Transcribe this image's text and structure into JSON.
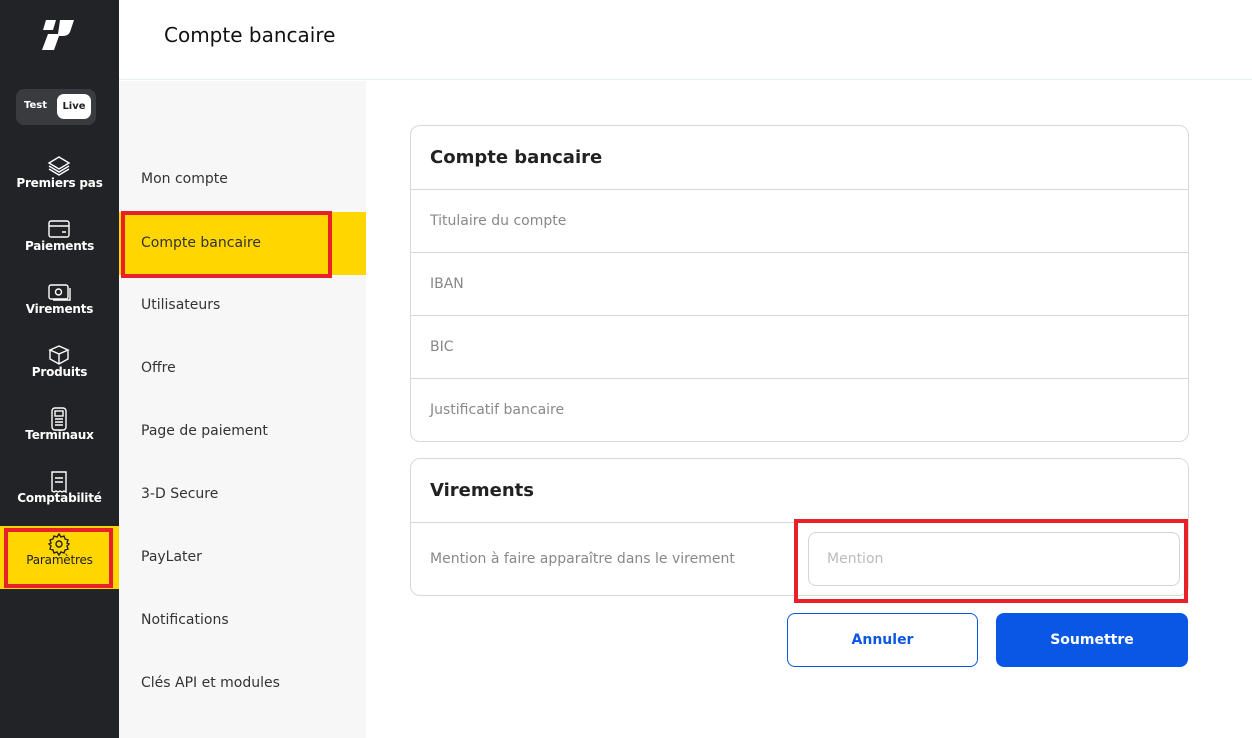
{
  "sidebar": {
    "env_toggle": {
      "test": "Test",
      "live": "Live",
      "selected": "Live"
    },
    "items": [
      {
        "label": "Premiers pas",
        "icon": "layers-icon"
      },
      {
        "label": "Paiements",
        "icon": "card-icon"
      },
      {
        "label": "Virements",
        "icon": "transfer-icon"
      },
      {
        "label": "Produits",
        "icon": "box-icon"
      },
      {
        "label": "Terminaux",
        "icon": "terminal-icon"
      },
      {
        "label": "Comptabilité",
        "icon": "receipt-icon"
      },
      {
        "label": "Paramètres",
        "icon": "gear-icon",
        "active": true
      }
    ]
  },
  "header": {
    "title": "Compte bancaire"
  },
  "subnav": {
    "items": [
      "Mon compte",
      "Compte bancaire",
      "Utilisateurs",
      "Offre",
      "Page de paiement",
      "3-D Secure",
      "PayLater",
      "Notifications",
      "Clés API et modules"
    ],
    "active": "Compte bancaire"
  },
  "bank_card": {
    "title": "Compte bancaire",
    "rows": [
      "Titulaire du compte",
      "IBAN",
      "BIC",
      "Justificatif bancaire"
    ]
  },
  "transfer_card": {
    "title": "Virements",
    "mention_label": "Mention à faire apparaître dans le virement",
    "mention_placeholder": "Mention",
    "mention_value": ""
  },
  "actions": {
    "cancel": "Annuler",
    "submit": "Soumettre"
  },
  "colors": {
    "sidebar": "#222326",
    "accent": "#ffd600",
    "primary": "#0a57e6",
    "highlight": "#e8202a"
  }
}
